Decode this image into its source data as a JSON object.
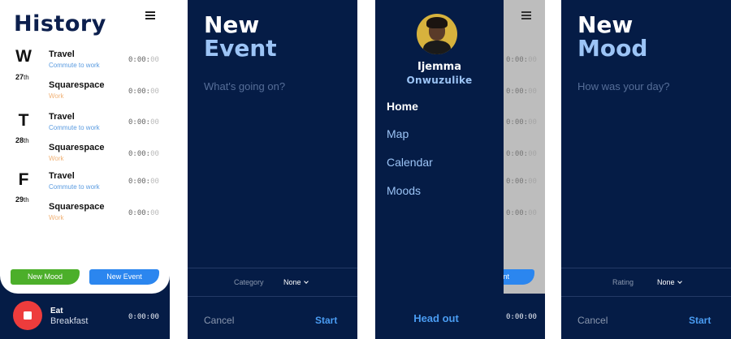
{
  "history": {
    "title": "History",
    "days": [
      {
        "letter": "W",
        "num": "27",
        "suffix": "th"
      },
      {
        "letter": "T",
        "num": "28",
        "suffix": "th"
      },
      {
        "letter": "F",
        "num": "29",
        "suffix": "th"
      }
    ],
    "entries": [
      {
        "name": "Travel",
        "category": "Commute to work",
        "time": "0:00:",
        "time_dim": "00"
      },
      {
        "name": "Squarespace",
        "category": "Work",
        "time": "0:00:",
        "time_dim": "00"
      },
      {
        "name": "Travel",
        "category": "Commute to work",
        "time": "0:00:",
        "time_dim": "00"
      },
      {
        "name": "Squarespace",
        "category": "Work",
        "time": "0:00:",
        "time_dim": "00"
      },
      {
        "name": "Travel",
        "category": "Commute to work",
        "time": "0:00:",
        "time_dim": "00"
      },
      {
        "name": "Squarespace",
        "category": "Work",
        "time": "0:00:",
        "time_dim": "00"
      }
    ],
    "new_mood_label": "New Mood",
    "new_event_label": "New Event",
    "current": {
      "name": "Eat",
      "sub": "Breakfast",
      "time": "0:00:00"
    }
  },
  "new_event": {
    "title_line1": "New",
    "title_line2": "Event",
    "placeholder": "What's going on?",
    "field_label": "Category",
    "field_value": "None",
    "cancel_label": "Cancel",
    "start_label": "Start"
  },
  "drawer": {
    "first_name": "Ijemma",
    "last_name": "Onwuzulike",
    "nav": [
      "Home",
      "Map",
      "Calendar",
      "Moods"
    ],
    "active": "Home",
    "head_out_label": "Head out",
    "bg_event_label": "vent"
  },
  "new_mood": {
    "title_line1": "New",
    "title_line2": "Mood",
    "placeholder": "How was your day?",
    "field_label": "Rating",
    "field_value": "None",
    "cancel_label": "Cancel",
    "start_label": "Start"
  },
  "colors": {
    "navy": "#051c46",
    "accent_blue": "#2b86ef",
    "light_blue": "#9cc4f6",
    "mood_green": "#4caf2a",
    "stop_red": "#ee3c3c",
    "work_orange": "#f0b277"
  },
  "icons": [
    "menu-icon",
    "chevron-down-icon",
    "stop-icon",
    "avatar"
  ]
}
